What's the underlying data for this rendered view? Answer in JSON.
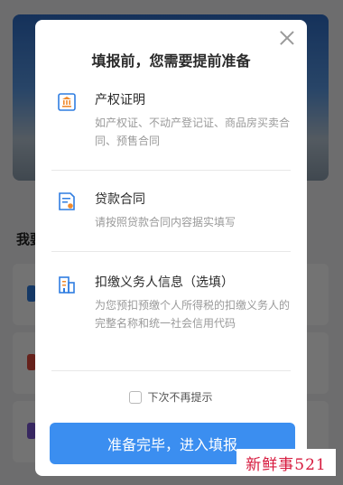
{
  "background": {
    "section_title": "我要"
  },
  "dialog": {
    "title": "填报前，您需要提前准备",
    "items": [
      {
        "icon": "certificate-icon",
        "title": "产权证明",
        "desc": "如产权证、不动产登记证、商品房买卖合同、预售合同"
      },
      {
        "icon": "contract-icon",
        "title": "贷款合同",
        "desc": "请按照贷款合同内容据实填写"
      },
      {
        "icon": "building-icon",
        "title": "扣缴义务人信息（选填）",
        "desc": "为您预扣预缴个人所得税的扣缴义务人的完整名称和统一社会信用代码"
      }
    ],
    "checkbox_label": "下次不再提示",
    "primary_button": "准备完毕，进入填报"
  },
  "watermark": "新鲜事521",
  "colors": {
    "accent": "#3b8ef0",
    "icon_blue": "#2f7de1",
    "icon_orange": "#f08a2c"
  }
}
